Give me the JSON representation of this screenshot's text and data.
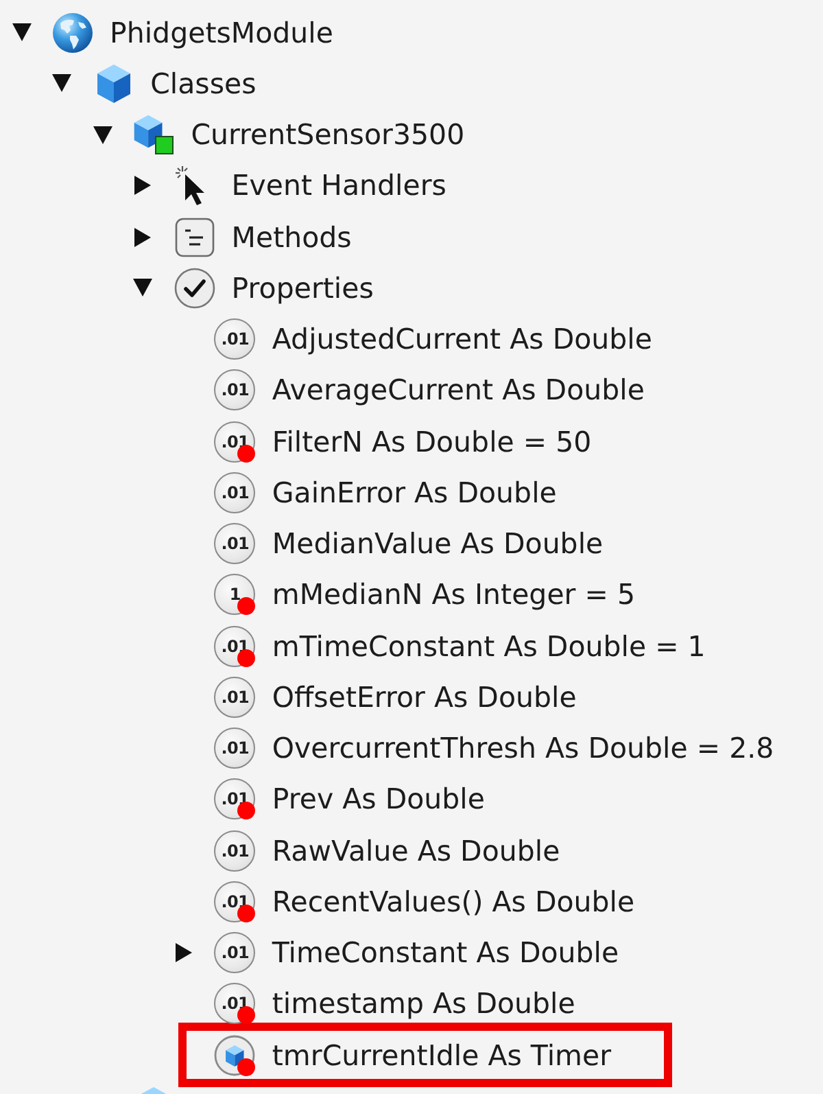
{
  "tree": [
    {
      "label": "PhidgetsModule",
      "kind": "globe",
      "expanded": true,
      "children": [
        {
          "label": "Classes",
          "kind": "cube",
          "expanded": true,
          "children": [
            {
              "label": "CurrentSensor3500",
              "kind": "class",
              "expanded": true,
              "children": [
                {
                  "label": "Event Handlers",
                  "kind": "event",
                  "expanded": false
                },
                {
                  "label": "Methods",
                  "kind": "methods",
                  "expanded": false
                },
                {
                  "label": "Properties",
                  "kind": "properties",
                  "expanded": true,
                  "children": [
                    {
                      "label": "AdjustedCurrent As Double",
                      "kind": "value",
                      "badge": ".01",
                      "private": false,
                      "highlighted": false
                    },
                    {
                      "label": "AverageCurrent As Double",
                      "kind": "value",
                      "badge": ".01",
                      "private": false,
                      "highlighted": false
                    },
                    {
                      "label": "FilterN As Double = 50",
                      "kind": "value",
                      "badge": ".01",
                      "private": true,
                      "highlighted": false
                    },
                    {
                      "label": "GainError As Double",
                      "kind": "value",
                      "badge": ".01",
                      "private": false,
                      "highlighted": false
                    },
                    {
                      "label": "MedianValue As Double",
                      "kind": "value",
                      "badge": ".01",
                      "private": false,
                      "highlighted": false
                    },
                    {
                      "label": "mMedianN As Integer = 5",
                      "kind": "value",
                      "badge": "1",
                      "private": true,
                      "highlighted": false
                    },
                    {
                      "label": "mTimeConstant As Double = 1",
                      "kind": "value",
                      "badge": ".01",
                      "private": true,
                      "highlighted": false
                    },
                    {
                      "label": "OffsetError As Double",
                      "kind": "value",
                      "badge": ".01",
                      "private": false,
                      "highlighted": false
                    },
                    {
                      "label": "OvercurrentThresh As Double = 2.8",
                      "kind": "value",
                      "badge": ".01",
                      "private": false,
                      "highlighted": false
                    },
                    {
                      "label": "Prev As Double",
                      "kind": "value",
                      "badge": ".01",
                      "private": true,
                      "highlighted": false
                    },
                    {
                      "label": "RawValue As Double",
                      "kind": "value",
                      "badge": ".01",
                      "private": false,
                      "highlighted": false
                    },
                    {
                      "label": "RecentValues() As Double",
                      "kind": "value",
                      "badge": ".01",
                      "private": true,
                      "highlighted": false
                    },
                    {
                      "label": "TimeConstant As Double",
                      "kind": "value",
                      "badge": ".01",
                      "private": false,
                      "highlighted": false,
                      "expanded": false
                    },
                    {
                      "label": "timestamp As Double",
                      "kind": "value",
                      "badge": ".01",
                      "private": true,
                      "highlighted": false
                    },
                    {
                      "label": "tmrCurrentIdle As Timer",
                      "kind": "object",
                      "private": true,
                      "highlighted": true
                    }
                  ]
                }
              ]
            },
            {
              "kind": "cube"
            }
          ]
        }
      ]
    }
  ]
}
